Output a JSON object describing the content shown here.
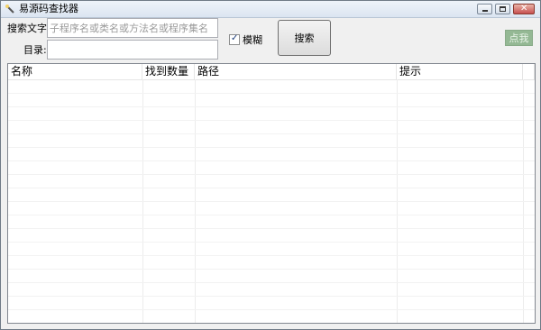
{
  "window": {
    "title": "易源码查找器",
    "icon": "search-wand-icon"
  },
  "search": {
    "label": "搜索文字:",
    "value": "",
    "placeholder": "子程序名或类名或方法名或程序集名"
  },
  "directory": {
    "label": "目录:",
    "value": ""
  },
  "fuzzy": {
    "label": "模糊",
    "checked": true
  },
  "buttons": {
    "search": "搜索",
    "click_me": "点我"
  },
  "results": {
    "columns": [
      "名称",
      "找到数量",
      "路径",
      "提示",
      ""
    ],
    "rows": []
  }
}
